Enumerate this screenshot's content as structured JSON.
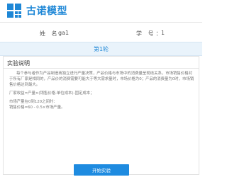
{
  "header": {
    "logo_icon": "grid-logo-icon",
    "title": "古诺模型"
  },
  "student": {
    "name_label": "姓 名：",
    "name_value": "ga1",
    "id_label": "学 号：",
    "id_value": "1"
  },
  "round": {
    "label": "第1轮"
  },
  "instructions": {
    "title": "实验说明",
    "paragraph1": "每个参与者作为产品制造商独立进行产量决策，产品价格与市场中的消费量呈现线关系，市场销售价格对于所有厂家是相同的，产品价的消费需要可能大于等大需求量时，市场价格为0；产品的消费量为0时，市场销售价格达到最大。",
    "formula_profit": "厂家收益=产量×(销售价格-单位成本)-固定成本；",
    "market_condition": "市场产量在0到120之间时：",
    "price_formula": "销售价格=60 - 0.5×市场产量。"
  },
  "actions": {
    "start_label": "开始实验"
  },
  "colors": {
    "accent": "#1e87d6",
    "round_bar_bg": "#e9f3fb"
  }
}
